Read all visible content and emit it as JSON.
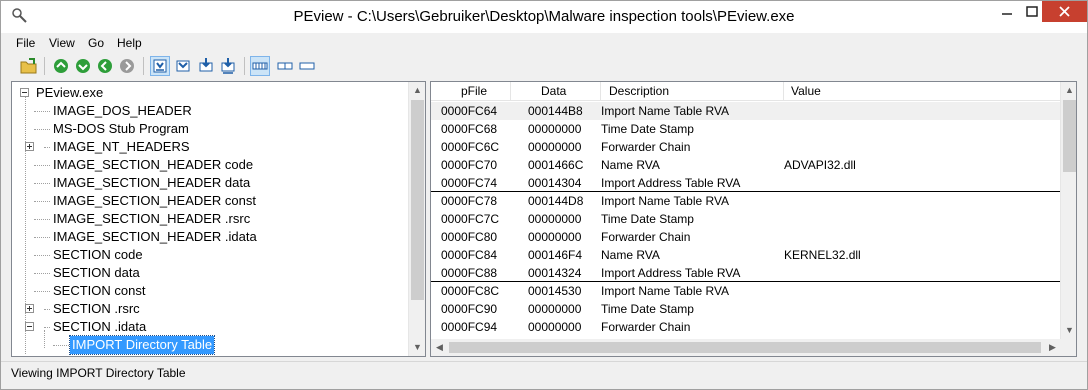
{
  "window": {
    "title": "PEview - C:\\Users\\Gebruiker\\Desktop\\Malware inspection tools\\PEview.exe",
    "app_icon": "magnifier-icon",
    "colors": {
      "close": "#c7402f",
      "selection": "#3399ff"
    }
  },
  "menu": [
    "File",
    "View",
    "Go",
    "Help"
  ],
  "toolbar": {
    "icons": [
      "open-folder-icon",
      "back-icon",
      "forward-icon",
      "previous-icon",
      "next-icon",
      "view-dos-header-icon",
      "view-nt-header-icon",
      "view-import-icon",
      "view-export-icon",
      "view-byte-icon",
      "view-word-icon",
      "view-dword-icon"
    ]
  },
  "tree": {
    "items": [
      {
        "label": "PEview.exe",
        "level": 0,
        "expander": "minus"
      },
      {
        "label": "IMAGE_DOS_HEADER",
        "level": 1,
        "expander": ""
      },
      {
        "label": "MS-DOS Stub Program",
        "level": 1,
        "expander": ""
      },
      {
        "label": "IMAGE_NT_HEADERS",
        "level": 1,
        "expander": "plus"
      },
      {
        "label": "IMAGE_SECTION_HEADER code",
        "level": 1,
        "expander": ""
      },
      {
        "label": "IMAGE_SECTION_HEADER data",
        "level": 1,
        "expander": ""
      },
      {
        "label": "IMAGE_SECTION_HEADER const",
        "level": 1,
        "expander": ""
      },
      {
        "label": "IMAGE_SECTION_HEADER .rsrc",
        "level": 1,
        "expander": ""
      },
      {
        "label": "IMAGE_SECTION_HEADER .idata",
        "level": 1,
        "expander": ""
      },
      {
        "label": "SECTION code",
        "level": 1,
        "expander": ""
      },
      {
        "label": "SECTION data",
        "level": 1,
        "expander": ""
      },
      {
        "label": "SECTION const",
        "level": 1,
        "expander": ""
      },
      {
        "label": "SECTION .rsrc",
        "level": 1,
        "expander": "plus"
      },
      {
        "label": "SECTION .idata",
        "level": 1,
        "expander": "minus"
      },
      {
        "label": "IMPORT Directory Table",
        "level": 2,
        "expander": "",
        "selected": true
      }
    ]
  },
  "list": {
    "columns": [
      "pFile",
      "Data",
      "Description",
      "Value"
    ],
    "rows": [
      [
        "0000FC64",
        "000144B8",
        "Import Name Table RVA",
        ""
      ],
      [
        "0000FC68",
        "00000000",
        "Time Date Stamp",
        ""
      ],
      [
        "0000FC6C",
        "00000000",
        "Forwarder Chain",
        ""
      ],
      [
        "0000FC70",
        "0001466C",
        "Name RVA",
        "ADVAPI32.dll"
      ],
      [
        "0000FC74",
        "00014304",
        "Import Address Table RVA",
        ""
      ],
      [
        "0000FC78",
        "000144D8",
        "Import Name Table RVA",
        ""
      ],
      [
        "0000FC7C",
        "00000000",
        "Time Date Stamp",
        ""
      ],
      [
        "0000FC80",
        "00000000",
        "Forwarder Chain",
        ""
      ],
      [
        "0000FC84",
        "000146F4",
        "Name RVA",
        "KERNEL32.dll"
      ],
      [
        "0000FC88",
        "00014324",
        "Import Address Table RVA",
        ""
      ],
      [
        "0000FC8C",
        "00014530",
        "Import Name Table RVA",
        ""
      ],
      [
        "0000FC90",
        "00000000",
        "Time Date Stamp",
        ""
      ],
      [
        "0000FC94",
        "00000000",
        "Forwarder Chain",
        ""
      ]
    ]
  },
  "status": "Viewing IMPORT Directory Table"
}
